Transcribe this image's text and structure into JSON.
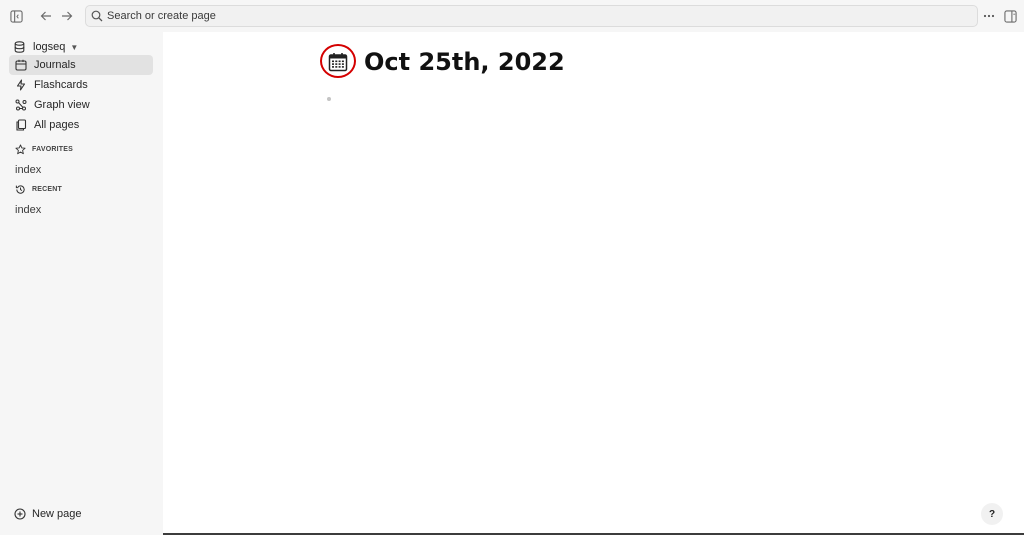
{
  "topbar": {
    "search_placeholder": "Search or create page"
  },
  "sidebar": {
    "repo_name": "logseq",
    "nav": [
      {
        "label": "Journals",
        "icon": "calendar-icon",
        "active": true
      },
      {
        "label": "Flashcards",
        "icon": "bolt-icon"
      },
      {
        "label": "Graph view",
        "icon": "graph-icon"
      },
      {
        "label": "All pages",
        "icon": "pages-icon"
      }
    ],
    "favorites": {
      "heading": "FAVORITES",
      "items": [
        "index"
      ]
    },
    "recent": {
      "heading": "RECENT",
      "items": [
        "index"
      ]
    },
    "new_page_label": "New page"
  },
  "main": {
    "page_title": "Oct 25th, 2022",
    "title_icon": "calendar-icon"
  },
  "help": {
    "label": "?"
  },
  "colors": {
    "accent_ring": "#d40000",
    "sidebar_bg": "#f6f6f6",
    "active_item": "#e2e2e2"
  }
}
